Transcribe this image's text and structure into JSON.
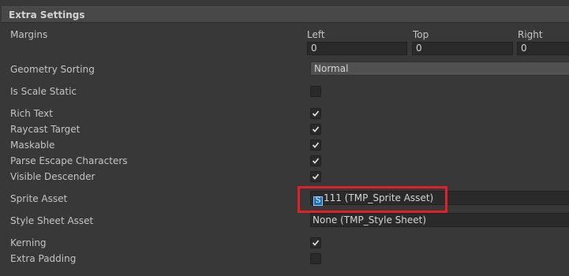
{
  "section": {
    "title": "Extra Settings"
  },
  "margins": {
    "label": "Margins",
    "left_label": "Left",
    "top_label": "Top",
    "right_label": "Right",
    "left_value": "0",
    "top_value": "0",
    "right_value": "0"
  },
  "geometry_sorting": {
    "label": "Geometry Sorting",
    "value": "Normal"
  },
  "is_scale_static": {
    "label": "Is Scale Static",
    "checked": false
  },
  "rich_text": {
    "label": "Rich Text",
    "checked": true
  },
  "raycast_target": {
    "label": "Raycast Target",
    "checked": true
  },
  "maskable": {
    "label": "Maskable",
    "checked": true
  },
  "parse_escape": {
    "label": "Parse Escape Characters",
    "checked": true
  },
  "visible_descender": {
    "label": "Visible Descender",
    "checked": true
  },
  "sprite_asset": {
    "label": "Sprite Asset",
    "icon": "sprite-asset-icon",
    "icon_glyph": "S",
    "value": "111 (TMP_Sprite Asset)"
  },
  "style_sheet_asset": {
    "label": "Style Sheet Asset",
    "value": "None (TMP_Style Sheet)"
  },
  "kerning": {
    "label": "Kerning",
    "checked": true
  },
  "extra_padding": {
    "label": "Extra Padding",
    "checked": false
  },
  "colors": {
    "highlight": "#e0202a",
    "sprite_icon": "#1f6fb8"
  }
}
